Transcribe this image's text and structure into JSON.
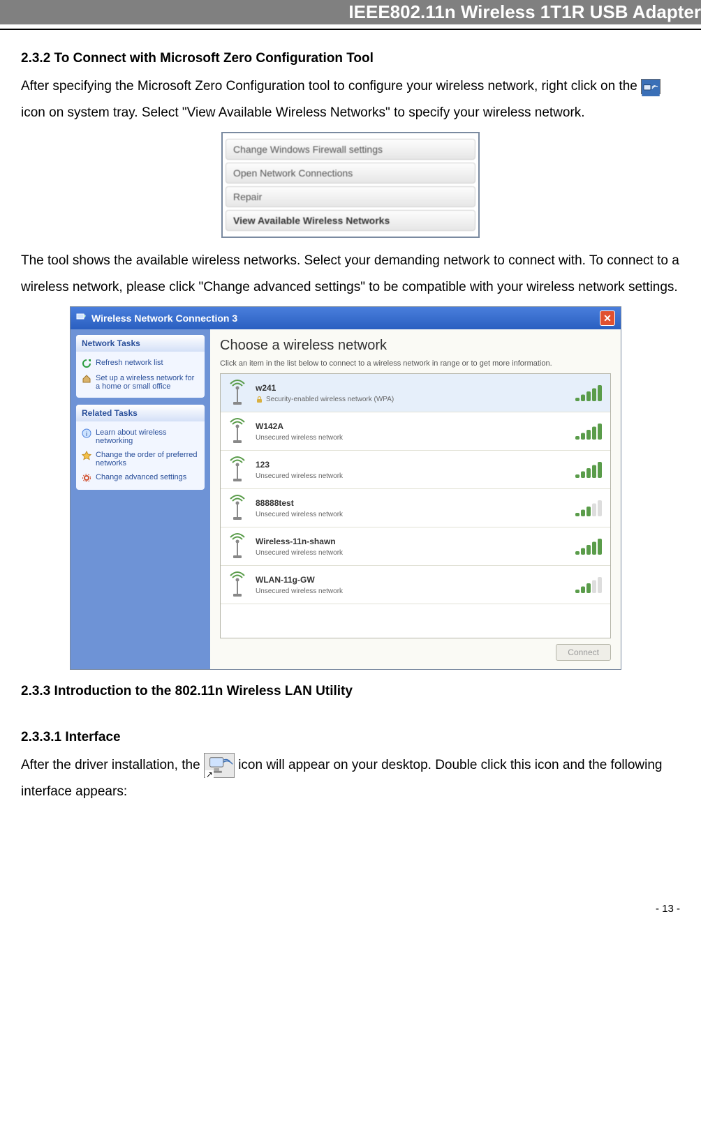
{
  "header_title": "IEEE802.11n Wireless 1T1R USB Adapter",
  "sec1": {
    "num": "2.3.2",
    "title": "  To Connect with Microsoft Zero Configuration Tool",
    "p1a": "After specifying the Microsoft Zero Configuration tool to configure your wireless network, right click on the ",
    "p1b": " icon on system tray. Select \"View Available Wireless Networks\" to specify your wireless network.",
    "p2": "The tool shows the available wireless networks. Select your demanding network to connect with. To connect to a wireless network, please click \"Change advanced settings\" to be compatible with your wireless network settings."
  },
  "context_menu": {
    "items": [
      {
        "label": "Change Windows Firewall settings",
        "bold": false
      },
      {
        "label": "Open Network Connections",
        "bold": false
      },
      {
        "label": "Repair",
        "bold": false
      },
      {
        "label": "View Available Wireless Networks",
        "bold": true
      }
    ]
  },
  "wnc": {
    "title": "Wireless Network Connection 3",
    "heading": "Choose a wireless network",
    "subheading": "Click an item in the list below to connect to a wireless network in range or to get more information.",
    "side": {
      "panel1": {
        "header": "Network Tasks",
        "links": [
          {
            "icon": "refresh",
            "text": "Refresh network list"
          },
          {
            "icon": "home",
            "text": "Set up a wireless network for a home or small office"
          }
        ]
      },
      "panel2": {
        "header": "Related Tasks",
        "links": [
          {
            "icon": "info",
            "text": "Learn about wireless networking"
          },
          {
            "icon": "star",
            "text": "Change the order of preferred networks"
          },
          {
            "icon": "gear",
            "text": "Change advanced settings"
          }
        ]
      }
    },
    "networks": [
      {
        "name": "w241",
        "desc": "Security-enabled wireless network (WPA)",
        "locked": true,
        "bars": 5,
        "selected": true
      },
      {
        "name": "W142A",
        "desc": "Unsecured wireless network",
        "locked": false,
        "bars": 5,
        "selected": false
      },
      {
        "name": "123",
        "desc": "Unsecured wireless network",
        "locked": false,
        "bars": 5,
        "selected": false
      },
      {
        "name": "88888test",
        "desc": "Unsecured wireless network",
        "locked": false,
        "bars": 3,
        "selected": false
      },
      {
        "name": "Wireless-11n-shawn",
        "desc": "Unsecured wireless network",
        "locked": false,
        "bars": 5,
        "selected": false
      },
      {
        "name": "WLAN-11g-GW",
        "desc": "Unsecured wireless network",
        "locked": false,
        "bars": 3,
        "selected": false
      }
    ],
    "connect_btn": "Connect"
  },
  "sec2": {
    "num": "2.3.3",
    "title": "  Introduction to the 802.11n Wireless LAN Utility"
  },
  "sec3": {
    "num": "2.3.3.1",
    "title": "  Interface",
    "p1a": "After the driver installation, the ",
    "p1b": " icon will appear on your desktop. Double click this icon and the following interface appears:"
  },
  "page_num": "- 13 -"
}
